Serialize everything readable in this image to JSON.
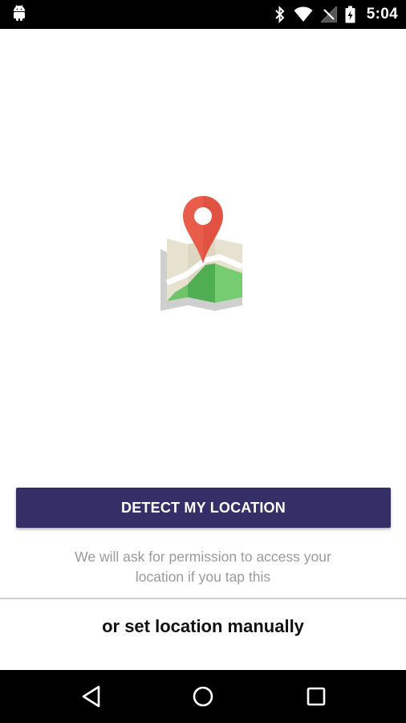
{
  "status_bar": {
    "time": "5:04",
    "icons": [
      "android-icon",
      "bluetooth-icon",
      "wifi-icon",
      "no-signal-icon",
      "battery-charging-icon"
    ]
  },
  "illustration": {
    "icon": "map-pin-illustration",
    "colors": {
      "pin": "#e85c4a",
      "map_beige": "#e6e0cf",
      "map_green": "#6fc46a",
      "map_green_dark": "#4fae52",
      "map_gray": "#c9c9c9"
    }
  },
  "detect_button": {
    "label": "DETECT MY LOCATION",
    "color": "#352f68"
  },
  "permission_note": {
    "line1": "We will ask for permission to access your",
    "line2": "location if you tap this"
  },
  "manual_option": {
    "label": "or set location manually"
  },
  "nav_bar": {
    "icons": [
      "back-icon",
      "home-icon",
      "recents-icon"
    ]
  }
}
